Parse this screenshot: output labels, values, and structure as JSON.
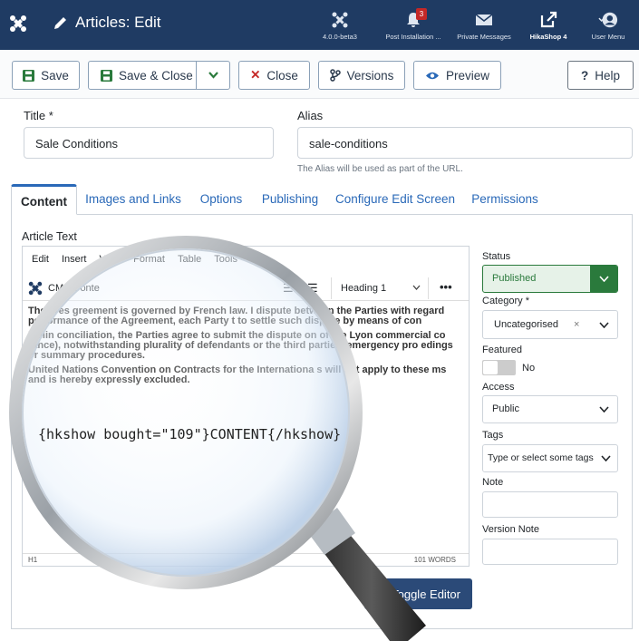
{
  "header": {
    "title": "Articles: Edit",
    "items": [
      {
        "label": "4.0.0-beta3",
        "icon": "joomla-icon"
      },
      {
        "label": "Post Installation ...",
        "icon": "bell-icon",
        "badge": "3"
      },
      {
        "label": "Private Messages",
        "icon": "envelope-icon"
      },
      {
        "label": "HikaShop 4",
        "icon": "external-link-icon"
      },
      {
        "label": "User Menu",
        "icon": "user-icon"
      }
    ]
  },
  "toolbar": {
    "save": "Save",
    "save_close": "Save & Close",
    "close": "Close",
    "versions": "Versions",
    "preview": "Preview",
    "help": "Help"
  },
  "form": {
    "title_label": "Title *",
    "title_value": "Sale Conditions",
    "alias_label": "Alias",
    "alias_value": "sale-conditions",
    "alias_hint": "The Alias will be used as part of the URL."
  },
  "tabs": [
    "Content",
    "Images and Links",
    "Options",
    "Publishing",
    "Configure Edit Screen",
    "Permissions"
  ],
  "editor": {
    "label": "Article Text",
    "menu": [
      "Edit",
      "Insert",
      "View",
      "Format",
      "Table",
      "Tools"
    ],
    "cms_content": "CMS Conte",
    "heading_select": "Heading 1",
    "paragraph_1": "The pres     greement is governed by French law. I     dispute between the Parties with regard        performance of the Agreement, each Party     t to settle such dispute by means of con",
    "paragraph_2": "Failin  conciliation, the Parties agree to submit the dispute     on of the Lyon commercial co       rance), notwithstanding plurality of defendants or the     third parties, emergency pro  edings or summary procedures.",
    "paragraph_3": "United Nations Convention on Contracts for the Internationa     s will not apply to these   ms and is hereby expressly excluded.",
    "lens_code": "{hkshow bought=\"109\"}CONTENT{/hkshow}",
    "status_path": "H1",
    "word_count": "101 WORDS"
  },
  "sidebar": {
    "status_label": "Status",
    "status_value": "Published",
    "category_label": "Category *",
    "category_value": "Uncategorised",
    "featured_label": "Featured",
    "featured_value": "No",
    "access_label": "Access",
    "access_value": "Public",
    "tags_label": "Tags",
    "tags_placeholder": "Type or select some tags",
    "note_label": "Note",
    "version_note_label": "Version Note"
  },
  "toggle_editor": "Toggle Editor"
}
